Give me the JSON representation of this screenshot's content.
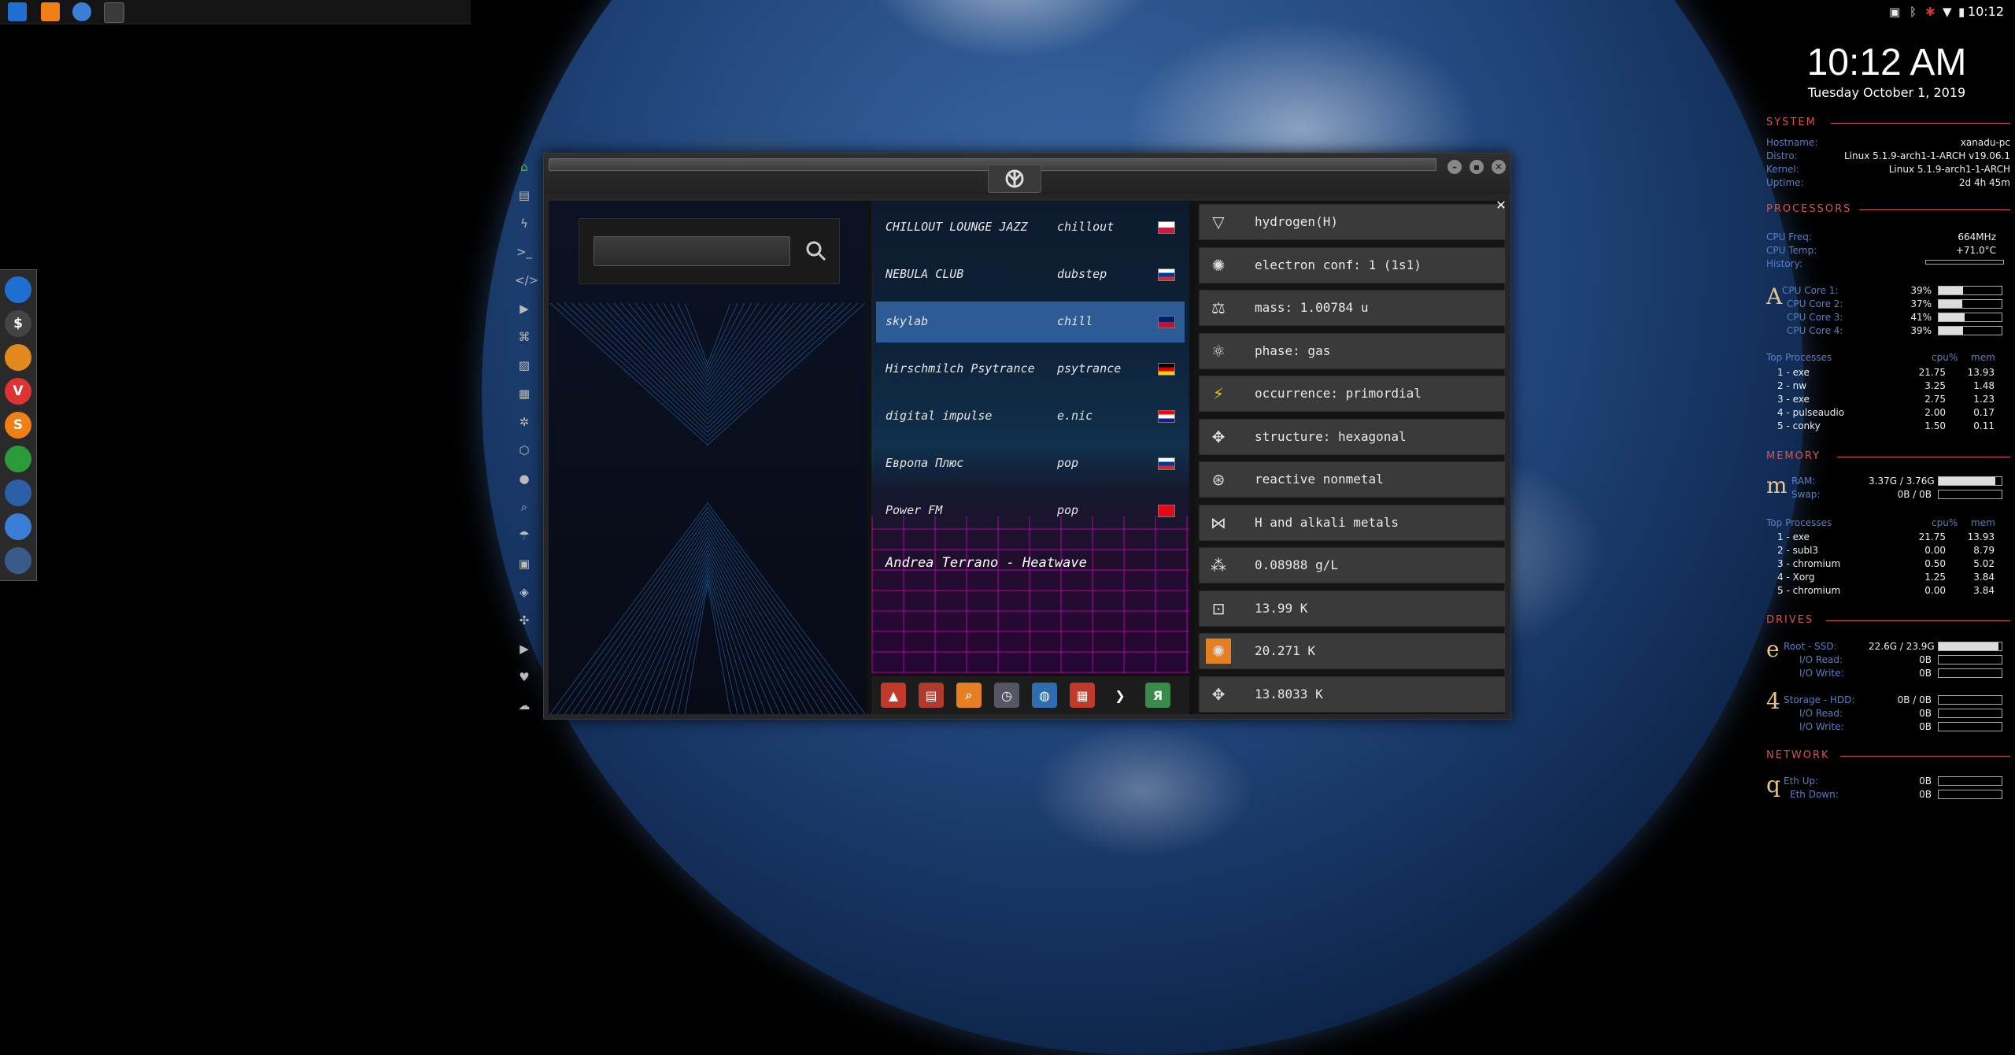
{
  "desktop": {
    "taskbar": {
      "items": [
        "file-manager-icon",
        "sublime-icon",
        "chromium-icon",
        "app-icon"
      ]
    },
    "tray": {
      "time": "10:12"
    },
    "dock": {
      "items": [
        {
          "icon": "files-icon",
          "color": "#1e6fd0",
          "label": ""
        },
        {
          "icon": "terminal-icon",
          "color": "#444",
          "label": "$"
        },
        {
          "icon": "ubuntu-icon",
          "color": "#e08a1e",
          "label": ""
        },
        {
          "icon": "vivaldi-icon",
          "color": "#d33",
          "label": "V"
        },
        {
          "icon": "sublime-icon",
          "color": "#f07f16",
          "label": "S"
        },
        {
          "icon": "monitor-icon",
          "color": "#2a9a3a",
          "label": ""
        },
        {
          "icon": "screenshot-icon",
          "color": "#2d5fa6",
          "label": ""
        },
        {
          "icon": "chrome-icon",
          "color": "#3a7fd5",
          "label": ""
        },
        {
          "icon": "grid-icon",
          "color": "#3a5a8a",
          "label": ""
        }
      ]
    }
  },
  "sidebar_icons": [
    {
      "name": "home-icon",
      "glyph": "⌂"
    },
    {
      "name": "document-icon",
      "glyph": "▤"
    },
    {
      "name": "bolt-icon",
      "glyph": "ϟ"
    },
    {
      "name": "terminal-icon",
      "glyph": ">_"
    },
    {
      "name": "code-icon",
      "glyph": "</>"
    },
    {
      "name": "play-icon",
      "glyph": "▶"
    },
    {
      "name": "translate-icon",
      "glyph": "⌘"
    },
    {
      "name": "image-icon",
      "glyph": "▨"
    },
    {
      "name": "news-icon",
      "glyph": "▦"
    },
    {
      "name": "atom-icon",
      "glyph": "✲"
    },
    {
      "name": "hexagon-icon",
      "glyph": "⬡"
    },
    {
      "name": "globe-icon",
      "glyph": "●"
    },
    {
      "name": "search-icon",
      "glyph": "⌕"
    },
    {
      "name": "umbrella-icon",
      "glyph": "☂"
    },
    {
      "name": "contact-icon",
      "glyph": "▣"
    },
    {
      "name": "link-icon",
      "glyph": "◈"
    },
    {
      "name": "expand-icon",
      "glyph": "✣"
    },
    {
      "name": "youtube-icon",
      "glyph": "▶"
    },
    {
      "name": "heart-icon",
      "glyph": "♥"
    },
    {
      "name": "cloud-icon",
      "glyph": "☁"
    }
  ],
  "window": {
    "search": {
      "value": "",
      "placeholder": ""
    },
    "stations": [
      {
        "name": "CHILLOUT LOUNGE JAZZ",
        "genre": "chillout",
        "flag": "pl",
        "active": false
      },
      {
        "name": "NEBULA CLUB",
        "genre": "dubstep",
        "flag": "ru",
        "active": false
      },
      {
        "name": "skylab",
        "genre": "chill",
        "flag": "gb",
        "active": true
      },
      {
        "name": "Hirschmilch Psytrance",
        "genre": "psytrance",
        "flag": "de",
        "active": false
      },
      {
        "name": "digital impulse",
        "genre": "e.nic",
        "flag": "hr",
        "active": false
      },
      {
        "name": "Европа Плюс",
        "genre": "pop",
        "flag": "ru",
        "active": false
      },
      {
        "name": "Power FM",
        "genre": "pop",
        "flag": "tr",
        "active": false
      }
    ],
    "now_playing": "Andrea Terrano - Heatwave",
    "app_bar": [
      {
        "icon": "arch-icon",
        "color": "#c0392b",
        "label": "▲"
      },
      {
        "icon": "calendar-app-icon",
        "color": "#b03a2e",
        "label": "▤"
      },
      {
        "icon": "search-app-icon",
        "color": "#e67e22",
        "label": "⌕"
      },
      {
        "icon": "clock-app-icon",
        "color": "#556",
        "label": "◷"
      },
      {
        "icon": "globe-app-icon",
        "color": "#2e6db0",
        "label": "◍"
      },
      {
        "icon": "calendar-icon",
        "color": "#c0392b",
        "label": "▦"
      },
      {
        "icon": "arrow-icon",
        "color": "#1c1c1c",
        "label": "❯"
      },
      {
        "icon": "yandex-icon",
        "color": "#3a8a4a",
        "label": "Я"
      }
    ],
    "element_info": [
      {
        "icon": "triangle-down-icon",
        "glyph": "▽",
        "text": "hydrogen(H)"
      },
      {
        "icon": "electron-icon",
        "glyph": "✺",
        "text": "electron conf: 1 (1s1)"
      },
      {
        "icon": "scale-icon",
        "glyph": "⚖",
        "text": "mass: 1.00784 u"
      },
      {
        "icon": "atom-icon",
        "glyph": "⚛",
        "text": "phase: gas"
      },
      {
        "icon": "lightning-icon",
        "glyph": "⚡",
        "text": "occurrence: primordial"
      },
      {
        "icon": "structure-icon",
        "glyph": "✥",
        "text": "structure: hexagonal"
      },
      {
        "icon": "reactive-icon",
        "glyph": "⊛",
        "text": "reactive nonmetal"
      },
      {
        "icon": "group-icon",
        "glyph": "⋈",
        "text": "H and alkali metals"
      },
      {
        "icon": "density-icon",
        "glyph": "⁂",
        "text": "0.08988 g/L"
      },
      {
        "icon": "melting-icon",
        "glyph": "⊡",
        "text": "13.99 K"
      },
      {
        "icon": "boiling-icon",
        "glyph": "✺",
        "text": "20.271 K"
      },
      {
        "icon": "triple-point-icon",
        "glyph": "✥",
        "text": "13.8033 K"
      }
    ]
  },
  "conky": {
    "clock": "10:12 AM",
    "date": "Tuesday October  1, 2019",
    "system": {
      "title": "SYSTEM",
      "rows": [
        {
          "label": "Hostname:",
          "value": "xanadu-pc"
        },
        {
          "label": "Distro:",
          "value": "Linux 5.1.9-arch1-1-ARCH v19.06.1"
        },
        {
          "label": "Kernel:",
          "value": "Linux 5.1.9-arch1-1-ARCH"
        },
        {
          "label": "Uptime:",
          "value": "2d 4h 45m"
        }
      ]
    },
    "processors": {
      "title": "PROCESSORS",
      "freq_label": "CPU Freq:",
      "freq": "664MHz",
      "temp_label": "CPU Temp:",
      "temp": "+71.0°C",
      "history_label": "History:",
      "letter": "A",
      "cores": [
        {
          "label": "CPU Core 1:",
          "value": "39%",
          "level": 0.39
        },
        {
          "label": "CPU Core 2:",
          "value": "37%",
          "level": 0.37
        },
        {
          "label": "CPU Core 3:",
          "value": "41%",
          "level": 0.41
        },
        {
          "label": "CPU Core 4:",
          "value": "39%",
          "level": 0.39
        }
      ],
      "top_title": "Top Processes",
      "col_cpu": "cpu%",
      "col_mem": "mem",
      "top": [
        {
          "name": "1 - exe",
          "cpu": "21.75",
          "mem": "13.93"
        },
        {
          "name": "2 - nw",
          "cpu": "3.25",
          "mem": "1.48"
        },
        {
          "name": "3 - exe",
          "cpu": "2.75",
          "mem": "1.23"
        },
        {
          "name": "4 - pulseaudio",
          "cpu": "2.00",
          "mem": "0.17"
        },
        {
          "name": "5 - conky",
          "cpu": "1.50",
          "mem": "0.11"
        }
      ]
    },
    "memory": {
      "title": "MEMORY",
      "letter": "m",
      "ram_label": "RAM:",
      "ram": "3.37G / 3.76G",
      "ram_level": 0.9,
      "swap_label": "Swap:",
      "swap": "0B / 0B",
      "top_title": "Top Processes",
      "col_cpu": "cpu%",
      "col_mem": "mem",
      "top": [
        {
          "name": "1 - exe",
          "cpu": "21.75",
          "mem": "13.93"
        },
        {
          "name": "2 - subl3",
          "cpu": "0.00",
          "mem": "8.79"
        },
        {
          "name": "3 - chromium",
          "cpu": "0.50",
          "mem": "5.02"
        },
        {
          "name": "4 - Xorg",
          "cpu": "1.25",
          "mem": "3.84"
        },
        {
          "name": "5 - chromium",
          "cpu": "0.00",
          "mem": "3.84"
        }
      ]
    },
    "drives": {
      "title": "DRIVES",
      "root_letter": "e",
      "root_label": "Root - SSD:",
      "root": "22.6G / 23.9G",
      "root_level": 0.95,
      "root_read_label": "I/O Read:",
      "root_read": "0B",
      "root_write_label": "I/O Write:",
      "root_write": "0B",
      "storage_letter": "4",
      "storage_label": "Storage - HDD:",
      "storage": "0B / 0B",
      "storage_read_label": "I/O Read:",
      "storage_read": "0B",
      "storage_write_label": "I/O Write:",
      "storage_write": "0B"
    },
    "network": {
      "title": "NETWORK",
      "letter": "q",
      "up_label": "Eth Up:",
      "up": "0B",
      "down_label": "Eth Down:",
      "down": "0B"
    }
  }
}
